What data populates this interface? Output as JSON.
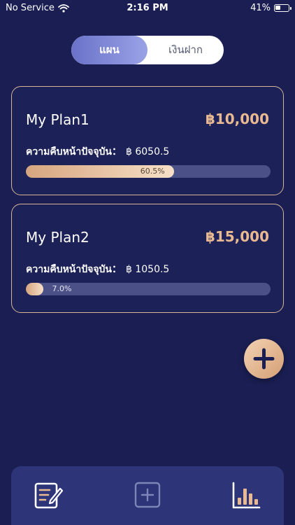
{
  "status_bar": {
    "carrier": "No Service",
    "time": "2:16 PM",
    "battery_percent": "41%",
    "battery_level": 0.41
  },
  "segment": {
    "plan_label": "แผน",
    "deposit_label": "เงินฝาก",
    "selected": "plan"
  },
  "plans": [
    {
      "name": "My Plan1",
      "amount": "฿10,000",
      "progress_label": "ความคืบหน้าปัจจุบัน：",
      "progress_value": "฿ 6050.5",
      "percent_text": "60.5%",
      "percent": 60.5
    },
    {
      "name": "My Plan2",
      "amount": "฿15,000",
      "progress_label": "ความคืบหน้าปัจจุบัน：",
      "progress_value": "฿ 1050.5",
      "percent_text": "7.0%",
      "percent": 7.0
    }
  ],
  "fab": {
    "icon": "plus-icon"
  },
  "tabbar": {
    "items": [
      {
        "icon": "edit-document-icon",
        "active": true
      },
      {
        "icon": "add-square-icon",
        "active": false
      },
      {
        "icon": "bar-chart-icon",
        "active": true
      }
    ]
  },
  "colors": {
    "background": "#1a1e52",
    "accent": "#e9b992",
    "card_border": "#d7b596",
    "tabbar": "#2d3478",
    "progress_track": "#4b5086"
  }
}
